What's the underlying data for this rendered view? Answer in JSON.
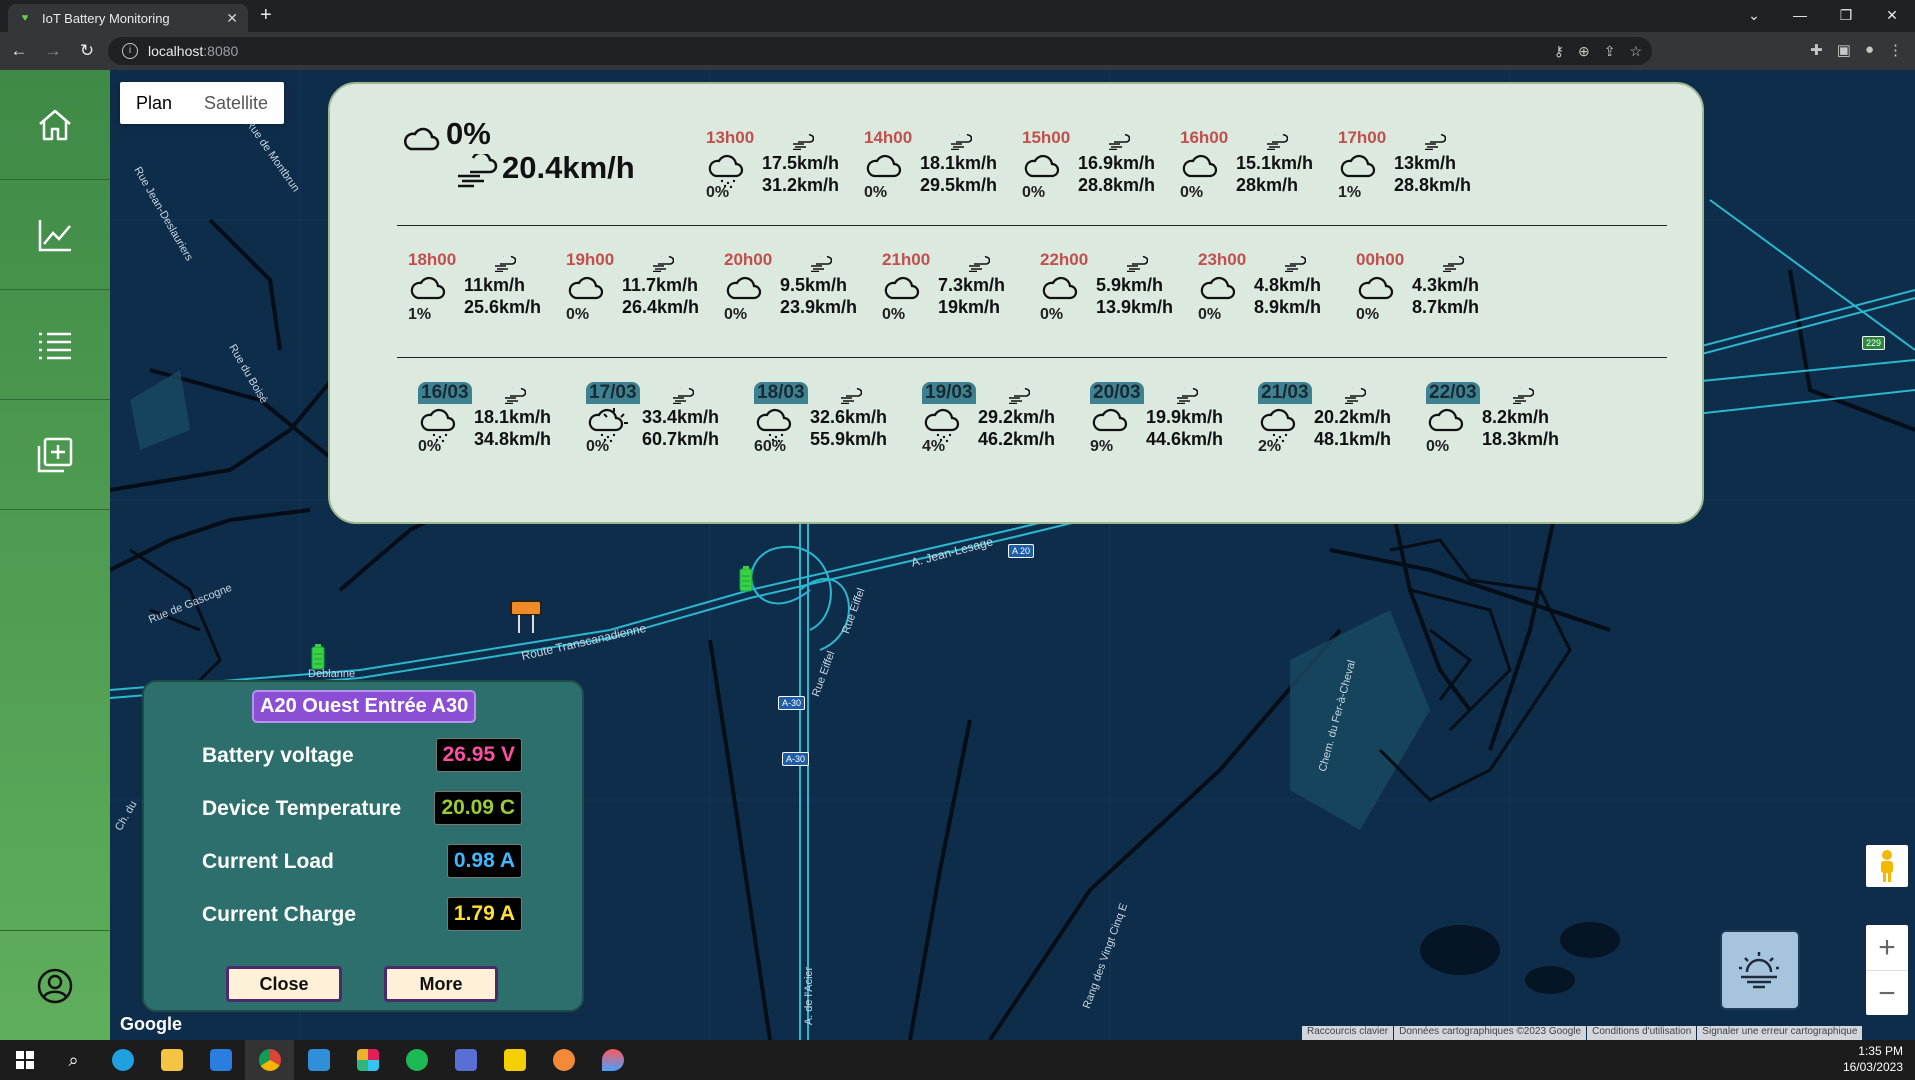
{
  "browser": {
    "tab_title": "IoT Battery Monitoring",
    "url_host": "localhost",
    "url_port": ":8080"
  },
  "sidebar": {
    "items": [
      {
        "icon": "home-icon"
      },
      {
        "icon": "chart-icon"
      },
      {
        "icon": "list-icon"
      },
      {
        "icon": "add-icon"
      }
    ],
    "bottom_icon": "user-icon"
  },
  "map_type": {
    "plan": "Plan",
    "satellite": "Satellite"
  },
  "map_labels": [
    "Rue Jean-Deslauriers",
    "Rue de Montbrun",
    "Rue du Boisé",
    "Rue de Gascogne",
    "Route Transcanadienne",
    "A. Jean-Lesage",
    "Rue Eiffel",
    "Rue Eiffel",
    "A. de l'Acier",
    "Chem. du Fer-à-Cheval",
    "Rang des Vingt Cinq E",
    "Ch. du",
    "Deblanne"
  ],
  "map_shields": [
    "A 20",
    "A-30",
    "A-30",
    "229"
  ],
  "weather": {
    "current": {
      "precip": "0%",
      "wind": "20.4km/h"
    },
    "hourly_row1": [
      {
        "time": "13h00",
        "precip": "0%",
        "wind": "17.5km/h",
        "gust": "31.2km/h",
        "icon": "cloud-rain"
      },
      {
        "time": "14h00",
        "precip": "0%",
        "wind": "18.1km/h",
        "gust": "29.5km/h",
        "icon": "cloud"
      },
      {
        "time": "15h00",
        "precip": "0%",
        "wind": "16.9km/h",
        "gust": "28.8km/h",
        "icon": "cloud"
      },
      {
        "time": "16h00",
        "precip": "0%",
        "wind": "15.1km/h",
        "gust": "28km/h",
        "icon": "cloud"
      },
      {
        "time": "17h00",
        "precip": "1%",
        "wind": "13km/h",
        "gust": "28.8km/h",
        "icon": "cloud"
      }
    ],
    "hourly_row2": [
      {
        "time": "18h00",
        "precip": "1%",
        "wind": "11km/h",
        "gust": "25.6km/h",
        "icon": "cloud"
      },
      {
        "time": "19h00",
        "precip": "0%",
        "wind": "11.7km/h",
        "gust": "26.4km/h",
        "icon": "cloud"
      },
      {
        "time": "20h00",
        "precip": "0%",
        "wind": "9.5km/h",
        "gust": "23.9km/h",
        "icon": "cloud"
      },
      {
        "time": "21h00",
        "precip": "0%",
        "wind": "7.3km/h",
        "gust": "19km/h",
        "icon": "cloud"
      },
      {
        "time": "22h00",
        "precip": "0%",
        "wind": "5.9km/h",
        "gust": "13.9km/h",
        "icon": "cloud"
      },
      {
        "time": "23h00",
        "precip": "0%",
        "wind": "4.8km/h",
        "gust": "8.9km/h",
        "icon": "cloud"
      },
      {
        "time": "00h00",
        "precip": "0%",
        "wind": "4.3km/h",
        "gust": "8.7km/h",
        "icon": "cloud"
      }
    ],
    "daily": [
      {
        "day": "16/03",
        "precip": "0%",
        "wind": "18.1km/h",
        "gust": "34.8km/h",
        "icon": "cloud-rain"
      },
      {
        "day": "17/03",
        "precip": "0%",
        "wind": "33.4km/h",
        "gust": "60.7km/h",
        "icon": "sun-cloud-rain"
      },
      {
        "day": "18/03",
        "precip": "60%",
        "wind": "32.6km/h",
        "gust": "55.9km/h",
        "icon": "cloud-rain"
      },
      {
        "day": "19/03",
        "precip": "4%",
        "wind": "29.2km/h",
        "gust": "46.2km/h",
        "icon": "cloud-rain"
      },
      {
        "day": "20/03",
        "precip": "9%",
        "wind": "19.9km/h",
        "gust": "44.6km/h",
        "icon": "cloud"
      },
      {
        "day": "21/03",
        "precip": "2%",
        "wind": "20.2km/h",
        "gust": "48.1km/h",
        "icon": "cloud-rain"
      },
      {
        "day": "22/03",
        "precip": "0%",
        "wind": "8.2km/h",
        "gust": "18.3km/h",
        "icon": "cloud"
      }
    ]
  },
  "station": {
    "title": "A20 Ouest Entrée A30",
    "rows": [
      {
        "label": "Battery voltage",
        "value": "26.95 V",
        "color": "#ff4fa3"
      },
      {
        "label": "Device Temperature",
        "value": "20.09 C",
        "color": "#9acd32"
      },
      {
        "label": "Current Load",
        "value": "0.98 A",
        "color": "#3fb8ff"
      },
      {
        "label": "Current Charge",
        "value": "1.79 A",
        "color": "#ffe033"
      }
    ],
    "close_label": "Close",
    "more_label": "More"
  },
  "map_footer": {
    "google": "Google",
    "attributions": [
      "Raccourcis clavier",
      "Données cartographiques ©2023 Google",
      "Conditions d'utilisation",
      "Signaler une erreur cartographique"
    ]
  },
  "taskbar": {
    "time": "1:35 PM",
    "date": "16/03/2023"
  }
}
